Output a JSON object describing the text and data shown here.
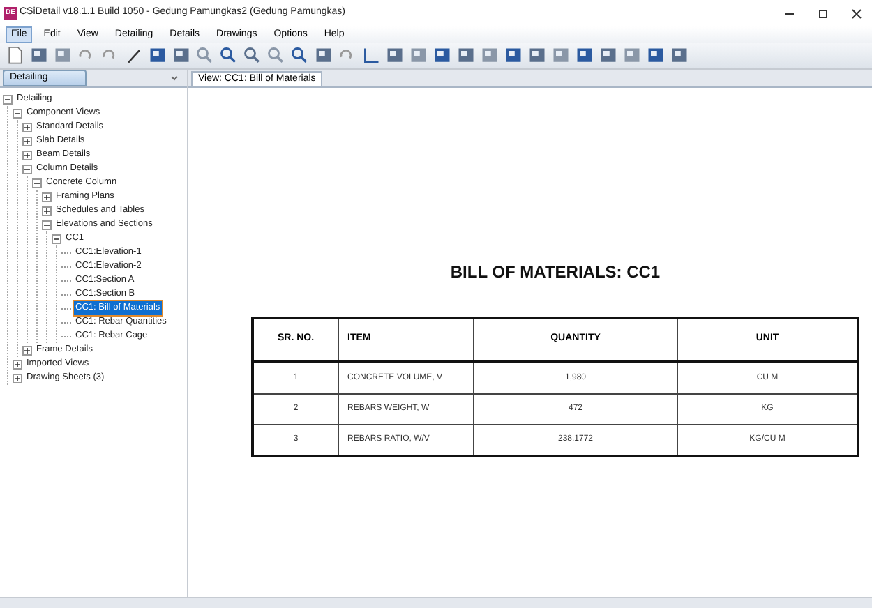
{
  "window": {
    "title": "CSiDetail v18.1.1 Build 1050 - Gedung Pamungkas2 (Gedung Pamungkas)",
    "app_icon": "DE"
  },
  "menu": [
    {
      "label": "File",
      "selected": true
    },
    {
      "label": "Edit",
      "selected": false
    },
    {
      "label": "View",
      "selected": false
    },
    {
      "label": "Detailing",
      "selected": false
    },
    {
      "label": "Details",
      "selected": false
    },
    {
      "label": "Drawings",
      "selected": false
    },
    {
      "label": "Options",
      "selected": false
    },
    {
      "label": "Help",
      "selected": false
    }
  ],
  "sidebar": {
    "tab": "Detailing",
    "tree": [
      {
        "label": "Detailing",
        "expanded": true,
        "selected": false,
        "children": [
          {
            "label": "Component Views",
            "expanded": true,
            "selected": false,
            "children": [
              {
                "label": "Standard Details",
                "expanded": false,
                "selected": false
              },
              {
                "label": "Slab Details",
                "expanded": false,
                "selected": false
              },
              {
                "label": "Beam Details",
                "expanded": false,
                "selected": false
              },
              {
                "label": "Column Details",
                "expanded": true,
                "selected": false,
                "children": [
                  {
                    "label": "Concrete Column",
                    "expanded": true,
                    "selected": false,
                    "children": [
                      {
                        "label": "Framing Plans",
                        "expanded": false,
                        "selected": false
                      },
                      {
                        "label": "Schedules and Tables",
                        "expanded": false,
                        "selected": false
                      },
                      {
                        "label": "Elevations and Sections",
                        "expanded": true,
                        "selected": false,
                        "children": [
                          {
                            "label": "CC1",
                            "expanded": true,
                            "selected": false,
                            "children": [
                              {
                                "label": "CC1:Elevation-1",
                                "selected": false
                              },
                              {
                                "label": "CC1:Elevation-2",
                                "selected": false
                              },
                              {
                                "label": "CC1:Section A",
                                "selected": false
                              },
                              {
                                "label": "CC1:Section B",
                                "selected": false
                              },
                              {
                                "label": "CC1: Bill of Materials",
                                "selected": true
                              },
                              {
                                "label": "CC1: Rebar Quantities",
                                "selected": false
                              },
                              {
                                "label": "CC1: Rebar Cage",
                                "selected": false
                              }
                            ]
                          }
                        ]
                      }
                    ]
                  }
                ]
              },
              {
                "label": "Frame Details",
                "expanded": false,
                "selected": false
              }
            ]
          },
          {
            "label": "Imported Views",
            "expanded": false,
            "selected": false
          },
          {
            "label": "Drawing Sheets (3)",
            "expanded": false,
            "selected": false
          }
        ]
      }
    ]
  },
  "document_tab": "View: CC1: Bill of Materials",
  "report": {
    "title": "BILL OF MATERIALS: CC1",
    "table": {
      "columns": [
        "SR. NO.",
        "ITEM",
        "QUANTITY",
        "UNIT"
      ],
      "rows": [
        [
          "1",
          "CONCRETE VOLUME, V",
          "1,980",
          "CU M"
        ],
        [
          "2",
          "REBARS WEIGHT, W",
          "472",
          "KG"
        ],
        [
          "3",
          "REBARS RATIO, W/V",
          "238.1772",
          "KG/CU M"
        ]
      ]
    }
  }
}
